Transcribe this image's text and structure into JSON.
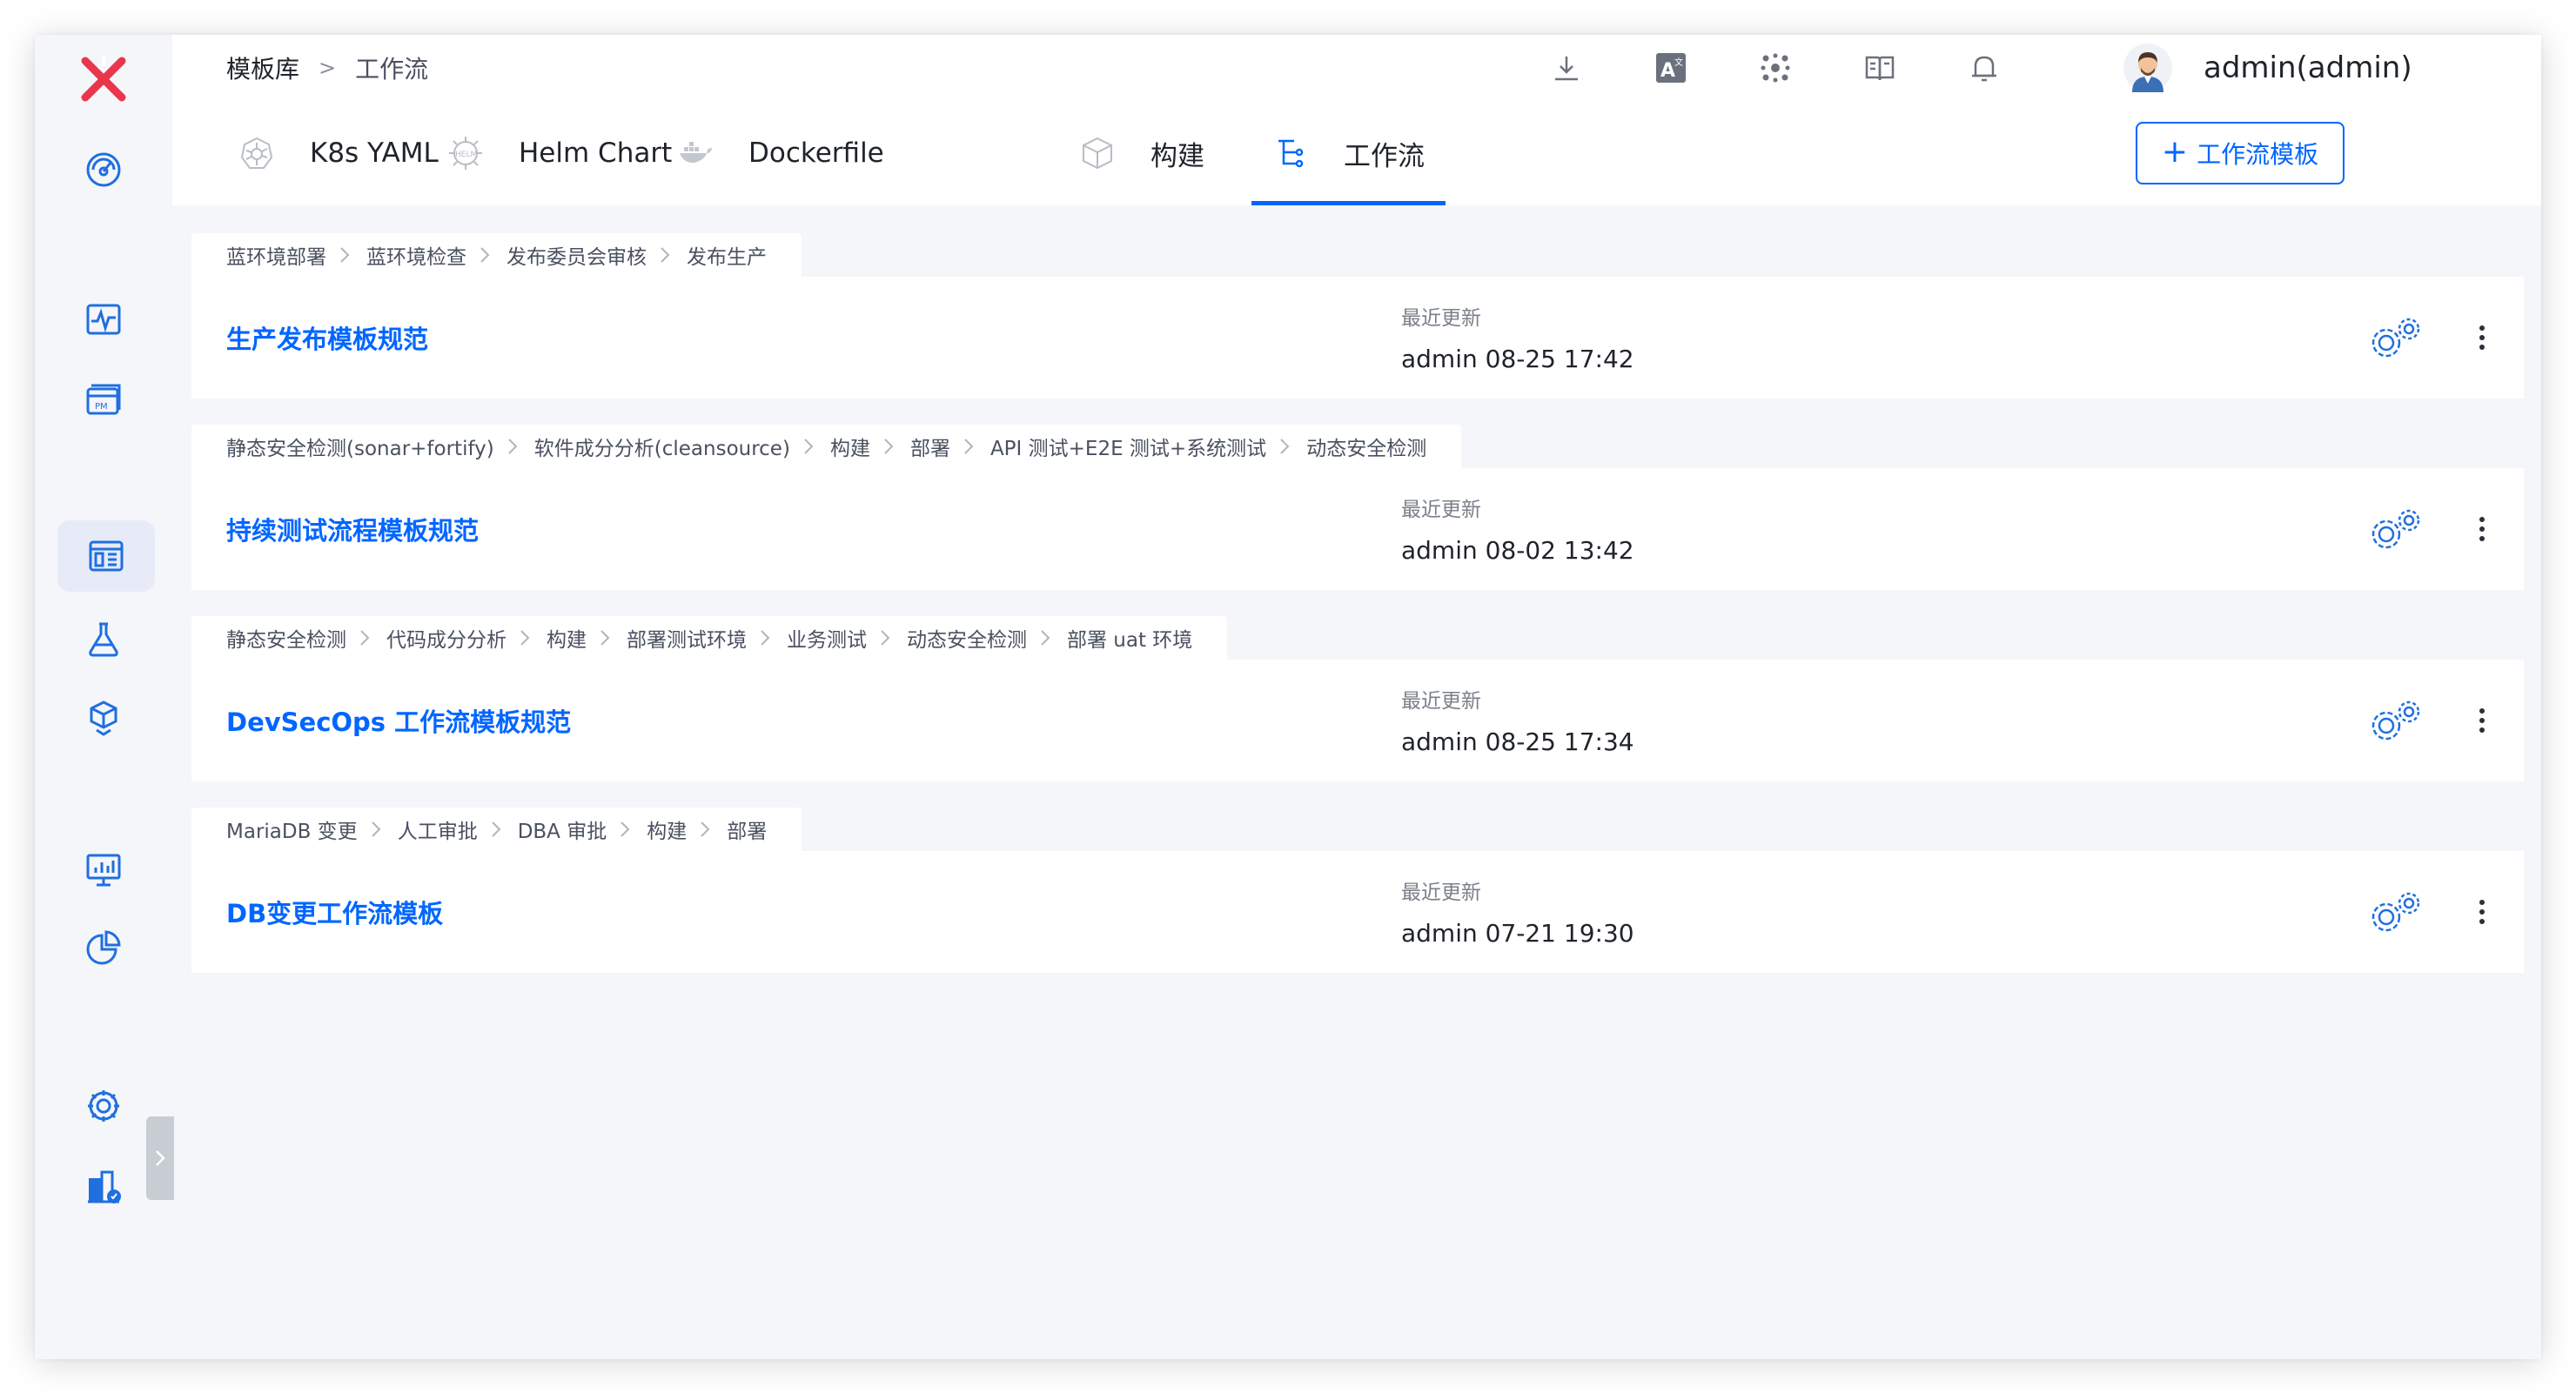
{
  "breadcrumb": {
    "root": "模板库",
    "separator": ">",
    "current": "工作流"
  },
  "header": {
    "user_name": "admin(admin)"
  },
  "tabs": [
    {
      "label": "K8s YAML",
      "icon": "kubernetes-icon"
    },
    {
      "label": "Helm Chart",
      "icon": "helm-icon"
    },
    {
      "label": "Dockerfile",
      "icon": "docker-icon"
    },
    {
      "label": "构建",
      "icon": "build-cube-icon"
    },
    {
      "label": "工作流",
      "icon": "workflow-icon",
      "active": true
    }
  ],
  "add_button": {
    "label": "工作流模板",
    "icon": "plus-icon"
  },
  "update_label": "最近更新",
  "workflows": [
    {
      "stages": [
        "蓝环境部署",
        "蓝环境检查",
        "发布委员会审核",
        "发布生产"
      ],
      "title": "生产发布模板规范",
      "updated": "admin 08-25 17:42"
    },
    {
      "stages": [
        "静态安全检测(sonar+fortify)",
        "软件成分分析(cleansource)",
        "构建",
        "部署",
        "API 测试+E2E 测试+系统测试",
        "动态安全检测"
      ],
      "title": "持续测试流程模板规范",
      "updated": "admin 08-02 13:42"
    },
    {
      "stages": [
        "静态安全检测",
        "代码成分分析",
        "构建",
        "部署测试环境",
        "业务测试",
        "动态安全检测",
        "部署 uat 环境"
      ],
      "title": "DevSecOps 工作流模板规范",
      "updated": "admin 08-25 17:34"
    },
    {
      "stages": [
        "MariaDB 变更",
        "人工审批",
        "DBA 审批",
        "构建",
        "部署"
      ],
      "title": "DB变更工作流模板",
      "updated": "admin 07-21 19:30"
    }
  ],
  "colors": {
    "accent": "#0066ff",
    "logo": "#e8374a",
    "sidebar_icon": "#1f6fe0"
  }
}
